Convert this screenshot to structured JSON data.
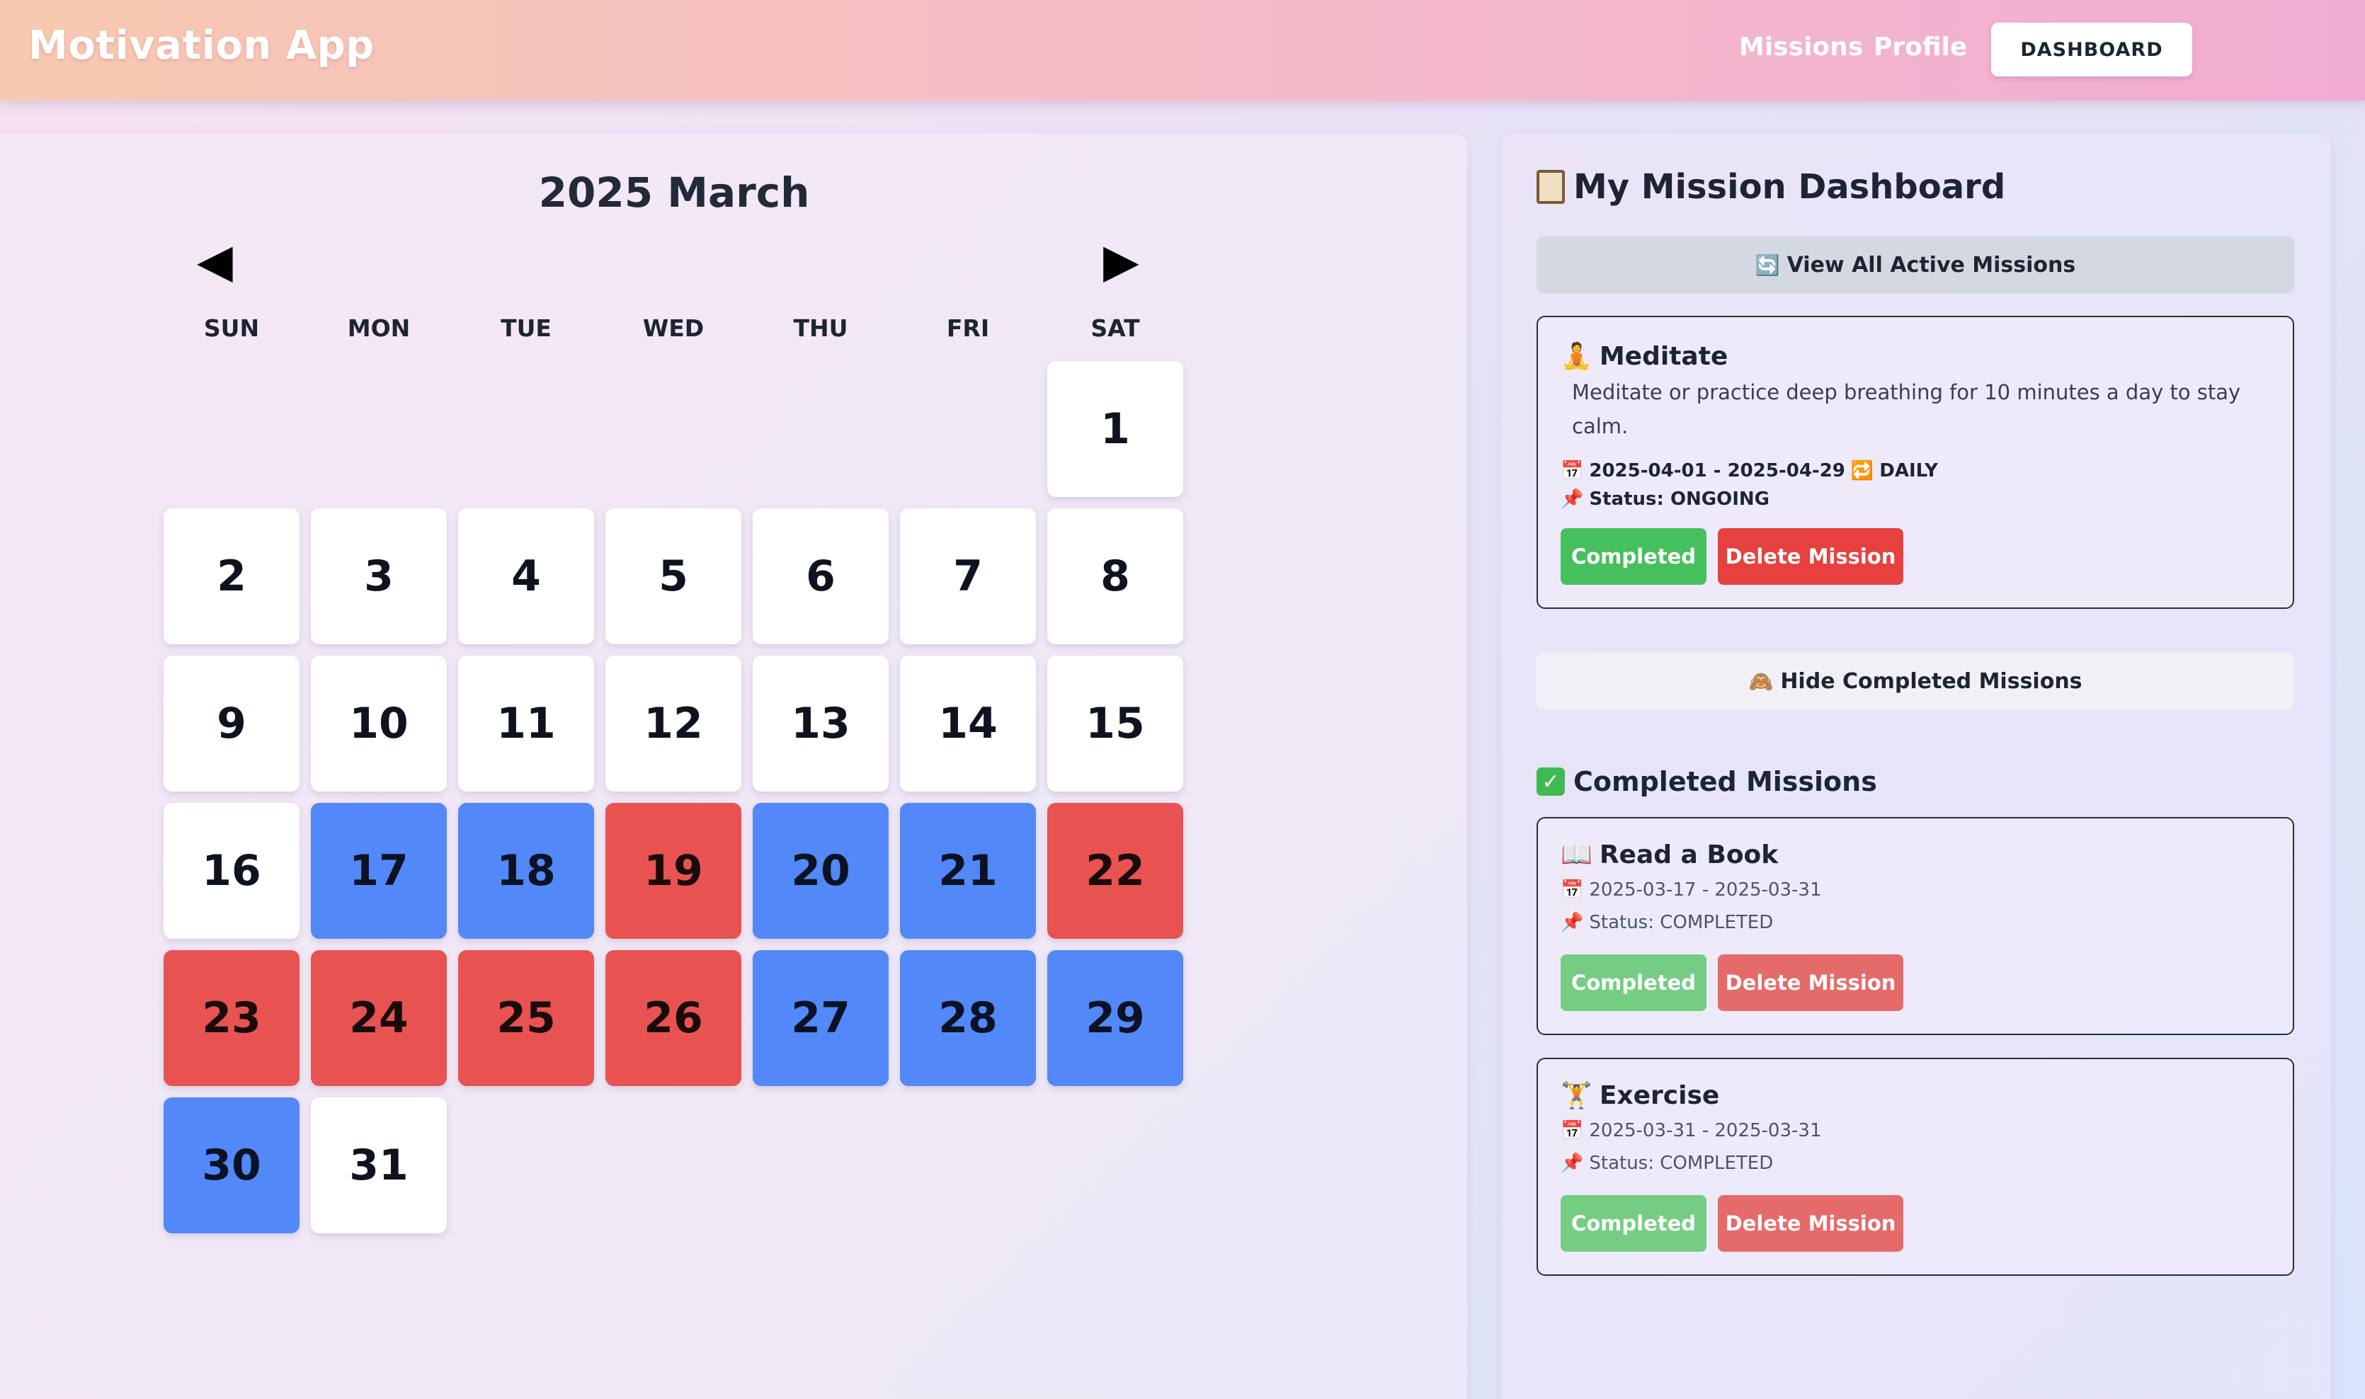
{
  "header": {
    "app_title": "Motivation App",
    "nav": {
      "missions": "Missions",
      "profile": "Profile",
      "dashboard": "DASHBOARD"
    }
  },
  "calendar": {
    "title": "2025 March",
    "prev_arrow": "◀",
    "next_arrow": "▶",
    "weekdays": [
      "SUN",
      "MON",
      "TUE",
      "WED",
      "THU",
      "FRI",
      "SAT"
    ],
    "first_weekday_index": 6,
    "days": [
      {
        "n": "1",
        "status": "none"
      },
      {
        "n": "2",
        "status": "none"
      },
      {
        "n": "3",
        "status": "none"
      },
      {
        "n": "4",
        "status": "none"
      },
      {
        "n": "5",
        "status": "none"
      },
      {
        "n": "6",
        "status": "none"
      },
      {
        "n": "7",
        "status": "none"
      },
      {
        "n": "8",
        "status": "none"
      },
      {
        "n": "9",
        "status": "none"
      },
      {
        "n": "10",
        "status": "none"
      },
      {
        "n": "11",
        "status": "none"
      },
      {
        "n": "12",
        "status": "none"
      },
      {
        "n": "13",
        "status": "none"
      },
      {
        "n": "14",
        "status": "none"
      },
      {
        "n": "15",
        "status": "none"
      },
      {
        "n": "16",
        "status": "none"
      },
      {
        "n": "17",
        "status": "blue"
      },
      {
        "n": "18",
        "status": "blue"
      },
      {
        "n": "19",
        "status": "red"
      },
      {
        "n": "20",
        "status": "blue"
      },
      {
        "n": "21",
        "status": "blue"
      },
      {
        "n": "22",
        "status": "red"
      },
      {
        "n": "23",
        "status": "red"
      },
      {
        "n": "24",
        "status": "red"
      },
      {
        "n": "25",
        "status": "red"
      },
      {
        "n": "26",
        "status": "red"
      },
      {
        "n": "27",
        "status": "blue"
      },
      {
        "n": "28",
        "status": "blue"
      },
      {
        "n": "29",
        "status": "blue"
      },
      {
        "n": "30",
        "status": "blue"
      },
      {
        "n": "31",
        "status": "none"
      }
    ],
    "colors": {
      "blue": "#5288f7",
      "red": "#e85352",
      "none": "#ffffff"
    }
  },
  "dashboard": {
    "heading": "My Mission Dashboard",
    "view_active_label": "View All Active Missions",
    "active_missions": [
      {
        "icon": "🧘",
        "title": "Meditate",
        "description": "Meditate or practice deep breathing for 10 minutes a day to stay calm.",
        "dates": "2025-04-01 - 2025-04-29",
        "frequency": "DAILY",
        "status": "Status: ONGOING",
        "complete_label": "Completed",
        "delete_label": "Delete Mission"
      }
    ],
    "hide_completed_label": "Hide Completed Missions",
    "completed_heading": "Completed Missions",
    "completed_missions": [
      {
        "icon": "📖",
        "title": "Read a Book",
        "dates": "2025-03-17 - 2025-03-31",
        "status": "Status: COMPLETED",
        "complete_label": "Completed",
        "delete_label": "Delete Mission"
      },
      {
        "icon": "🏋",
        "title": "Exercise",
        "dates": "2025-03-31 - 2025-03-31",
        "status": "Status: COMPLETED",
        "complete_label": "Completed",
        "delete_label": "Delete Mission"
      }
    ],
    "icons": {
      "heading": "clipboard-icon",
      "view_active": "refresh-icon",
      "hide_completed": "see-no-evil-monkey-icon",
      "completed_heading": "check-mark-icon",
      "date": "calendar-icon",
      "frequency": "repeat-icon",
      "status": "pushpin-icon"
    },
    "glyphs": {
      "view_active": "🔄",
      "hide_completed": "🙈",
      "check": "✓",
      "date": "📅",
      "frequency": "🔁",
      "status": "📌"
    }
  }
}
